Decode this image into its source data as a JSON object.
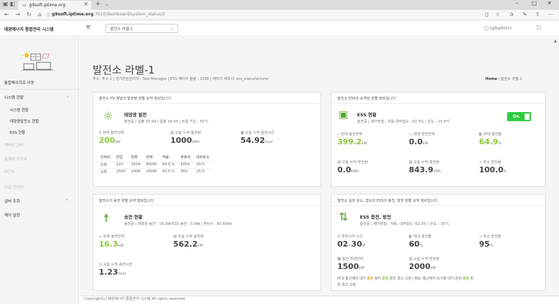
{
  "browser": {
    "tab_title": "g9soft.iptime.org",
    "url_host": "g9soft.iptime.org",
    "url_path": ":7010/dashboard/system_status/2"
  },
  "header": {
    "brand": "태양에너지 통합관리 시스템",
    "plant_select": "발전소 라벨-1",
    "user": "(g9admin)"
  },
  "sidebar": {
    "home_link": "통합페이지로 이동",
    "items": [
      {
        "label": "시스템 현황"
      },
      {
        "label": "시스템 현황"
      },
      {
        "label": "태양광발전소 현황"
      },
      {
        "label": "ESS 현황"
      },
      {
        "label": "배터리 관리"
      },
      {
        "label": "통계네 조지서"
      },
      {
        "label": "CCTV"
      },
      {
        "label": "긴급 관리자"
      },
      {
        "label": "실버 조회"
      },
      {
        "label": "제어 설정"
      }
    ]
  },
  "page": {
    "title": "발전소 라벨-1",
    "subtitle": "주소: 주소-1 | 전기안전관리자 : Test Manager | ESS 배터리 용량 : 1500 | 배터리 제조사: ess_manufacturer",
    "breadcrumb_home": "Home",
    "breadcrumb_current": "발전소 라벨-1"
  },
  "pv": {
    "head": "발전소 PV 패널의 발전량 현황 요약 정보입니다",
    "title": "태양광 발전",
    "desc": "발전중 | 일출 05:49 | 일몰 18:44 | 버결 기온 : 30°C",
    "m1_label": "현재 발전전력",
    "m1_value": "200",
    "m1_unit": "kW",
    "m2_label": "오늘 누적 발전량",
    "m2_value": "1000",
    "m2_unit": "kWh",
    "m3_label": "오늘 누적 발전시간",
    "m3_value": "54.92",
    "m3_unit": "hour",
    "table_headers": [
      "인버터",
      "전압",
      "전류",
      "전력",
      "역률",
      "주파수",
      "내부온도"
    ],
    "table_rows": [
      [
        "직류",
        "12V",
        "250A",
        "800W",
        "60.0 %",
        "50Hz",
        "25°C"
      ],
      [
        "교류",
        "250V",
        "240A",
        "100W",
        "60.0 %",
        "0Hz",
        "25°C"
      ]
    ]
  },
  "ess": {
    "head": "발전소 ESS의 요약된 현황 정보입니다",
    "title": "ESS 현황",
    "desc": "충전중 | 제어방법 : 자동 내부습도 : 62.3% | 온도 : 23.4°C",
    "toggle": "On",
    "m1_label": "현재 충전전력",
    "m1_value": "399.2",
    "m1_unit": "kW",
    "m2_label": "현재 방전전력",
    "m2_value": "0.0",
    "m2_unit": "kW",
    "m3_label": "최대 충전율",
    "m3_value": "64.9",
    "m3_unit": "%",
    "m4_label": "오늘 누적 방전량",
    "m4_value": "0.0",
    "m4_unit": "kWh",
    "m5_label": "오늘 누적 충전량",
    "m5_value": "843.9",
    "m5_unit": "kWh",
    "m6_label": "최소 방전율",
    "m6_value": "100.0",
    "m6_unit": "%"
  },
  "transmission": {
    "head": "발전소의 송전 현황 요약 정보입니다.",
    "title": "송전 현황",
    "desc": "송전중 | 태양광 송전 : 16.3㎾ ESS 송전 : 0.0㎾ | 주파수 : 60.60Hz",
    "m1_label": "현재 송전전력",
    "m1_value": "16.3",
    "m1_unit": "kW",
    "m2_label": "오늘 누적 송전량",
    "m2_value": "562.2",
    "m2_unit": "kW",
    "m3_label": "오늘 누적 송전시간",
    "m3_value": "1.23",
    "m3_unit": "hour"
  },
  "ess_charge": {
    "head": "발전소 실외 온도, 습도와 ESS의 충전, 방전 현황 요약 정보입니다",
    "title": "ESS 충전, 방전",
    "desc": "충전중 | 제어방법 : 자동, 내부습도: 62.3% | 온도 : 30°C",
    "m1_label": "방전시작 시간",
    "m1_value": "02",
    "m1_mid": "시",
    "m1_value2": "30",
    "m1_unit": "분",
    "m2_label": "최대 충전율",
    "m2_value": "60",
    "m2_unit": "%",
    "m3_label": "최소 방전율",
    "m3_value": "95",
    "m3_unit": "%",
    "m4_label": "충전 최대전력",
    "m4_value": "1500",
    "m4_unit": "kW",
    "m5_label": "오늘 누적 방전량",
    "m5_value": "2000",
    "m5_unit": "kW",
    "note_a": "PCS 통신에러 대기",
    "note_b": "방전",
    "note_c": "정지",
    "note_d": "충전",
    "note_e": "방전 경고 고장 | BSC 통신에러 조기화 대기 준비",
    "note_f": "충전",
    "note_g": "방",
    "note_h": "전 경고 고장"
  },
  "footer": "Copyright(c) 태양에너지 통합관리 시스템 All rights reserved."
}
